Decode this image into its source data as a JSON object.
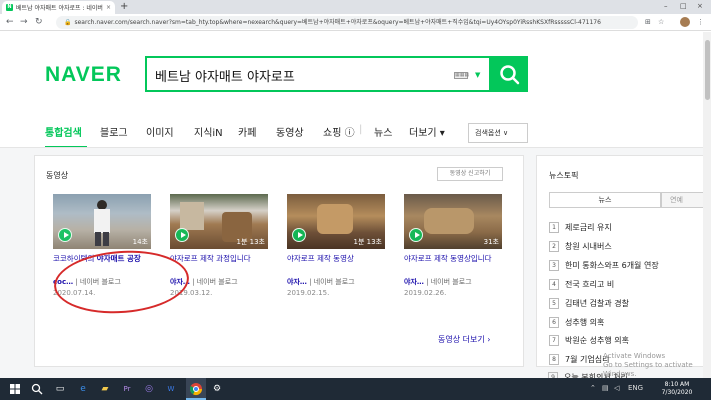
{
  "browser": {
    "tab_title": "베트남 야자매트 야자로프 : 네이버 통합검색",
    "tab_close": "×",
    "new_tab": "+",
    "url": "search.naver.com/search.naver?sm=tab_hty.top&where=nexearch&query=베트남+야자매트+야자로프&oquery=베트남+야자매트+직수입&tqi=Uy4OYsp0YiRsshKSXfRsssssCl-471176",
    "back": "←",
    "forward": "→",
    "reload": "↻",
    "lock": "🔒",
    "star": "☆",
    "minimize": "–",
    "maximize": "□",
    "close": "×",
    "menu": "⋮"
  },
  "header": {
    "brand": "NAVER",
    "query": "베트남 야자매트 야자로프",
    "keyboard": "▦▦▦",
    "caret": "▼"
  },
  "tabs": {
    "items": [
      {
        "label": "통합검색"
      },
      {
        "label": "블로그"
      },
      {
        "label": "이미지"
      },
      {
        "label": "지식iN"
      },
      {
        "label": "카페"
      },
      {
        "label": "동영상"
      },
      {
        "label": "쇼핑 ⓘ"
      },
      {
        "label": "| "
      },
      {
        "label": "뉴스"
      },
      {
        "label": "더보기 ▾"
      }
    ],
    "options": "검색옵션 ∨"
  },
  "videos": {
    "section_title": "동영상",
    "report_label": "동영상 신고하기",
    "items": [
      {
        "title_a": "코코하이텍의 ",
        "title_b": "야자매트 공장",
        "channel": "coc…",
        "source": "네이버 블로그",
        "date": "2020.07.14.",
        "duration": "14초"
      },
      {
        "title_a": "",
        "title_b": "야자로프 제작 과정입니다",
        "channel": "야자…",
        "source": "네이버 블로그",
        "date": "2019.03.12.",
        "duration": "1분 13초"
      },
      {
        "title_a": "",
        "title_b": "야자로프 제작 동영상",
        "channel": "야자…",
        "source": "네이버 블로그",
        "date": "2019.02.15.",
        "duration": "1분 13초"
      },
      {
        "title_a": "",
        "title_b": "야자로프 제작 동영상입니다",
        "channel": "야자…",
        "source": "네이버 블로그",
        "date": "2019.02.26.",
        "duration": "31초"
      }
    ],
    "more_label": "동영상 더보기 ›"
  },
  "news": {
    "title": "뉴스토픽",
    "tab_news": "뉴스",
    "tab_ent": "연예",
    "items": [
      {
        "num": "1",
        "text": "제로금리 유지"
      },
      {
        "num": "2",
        "text": "창원 시내버스"
      },
      {
        "num": "3",
        "text": "한미 통화스와프 6개월 연장"
      },
      {
        "num": "4",
        "text": "전국 흐리고 비"
      },
      {
        "num": "5",
        "text": "김태년 검찰과 경찰"
      },
      {
        "num": "6",
        "text": "성추행 의혹"
      },
      {
        "num": "7",
        "text": "박원순 성추행 의혹"
      },
      {
        "num": "8",
        "text": "7월 기업심리"
      },
      {
        "num": "9",
        "text": "오늘 본회의서 처리"
      }
    ]
  },
  "watermark": {
    "line1": "Activate Windows",
    "line2": "Go to Settings to activate Windows."
  },
  "taskbar": {
    "time": "8:10 AM",
    "date": "7/30/2020",
    "lang": "ENG"
  },
  "colors": {
    "brand_green": "#03c75a",
    "annotation_red": "#d62a2a"
  }
}
